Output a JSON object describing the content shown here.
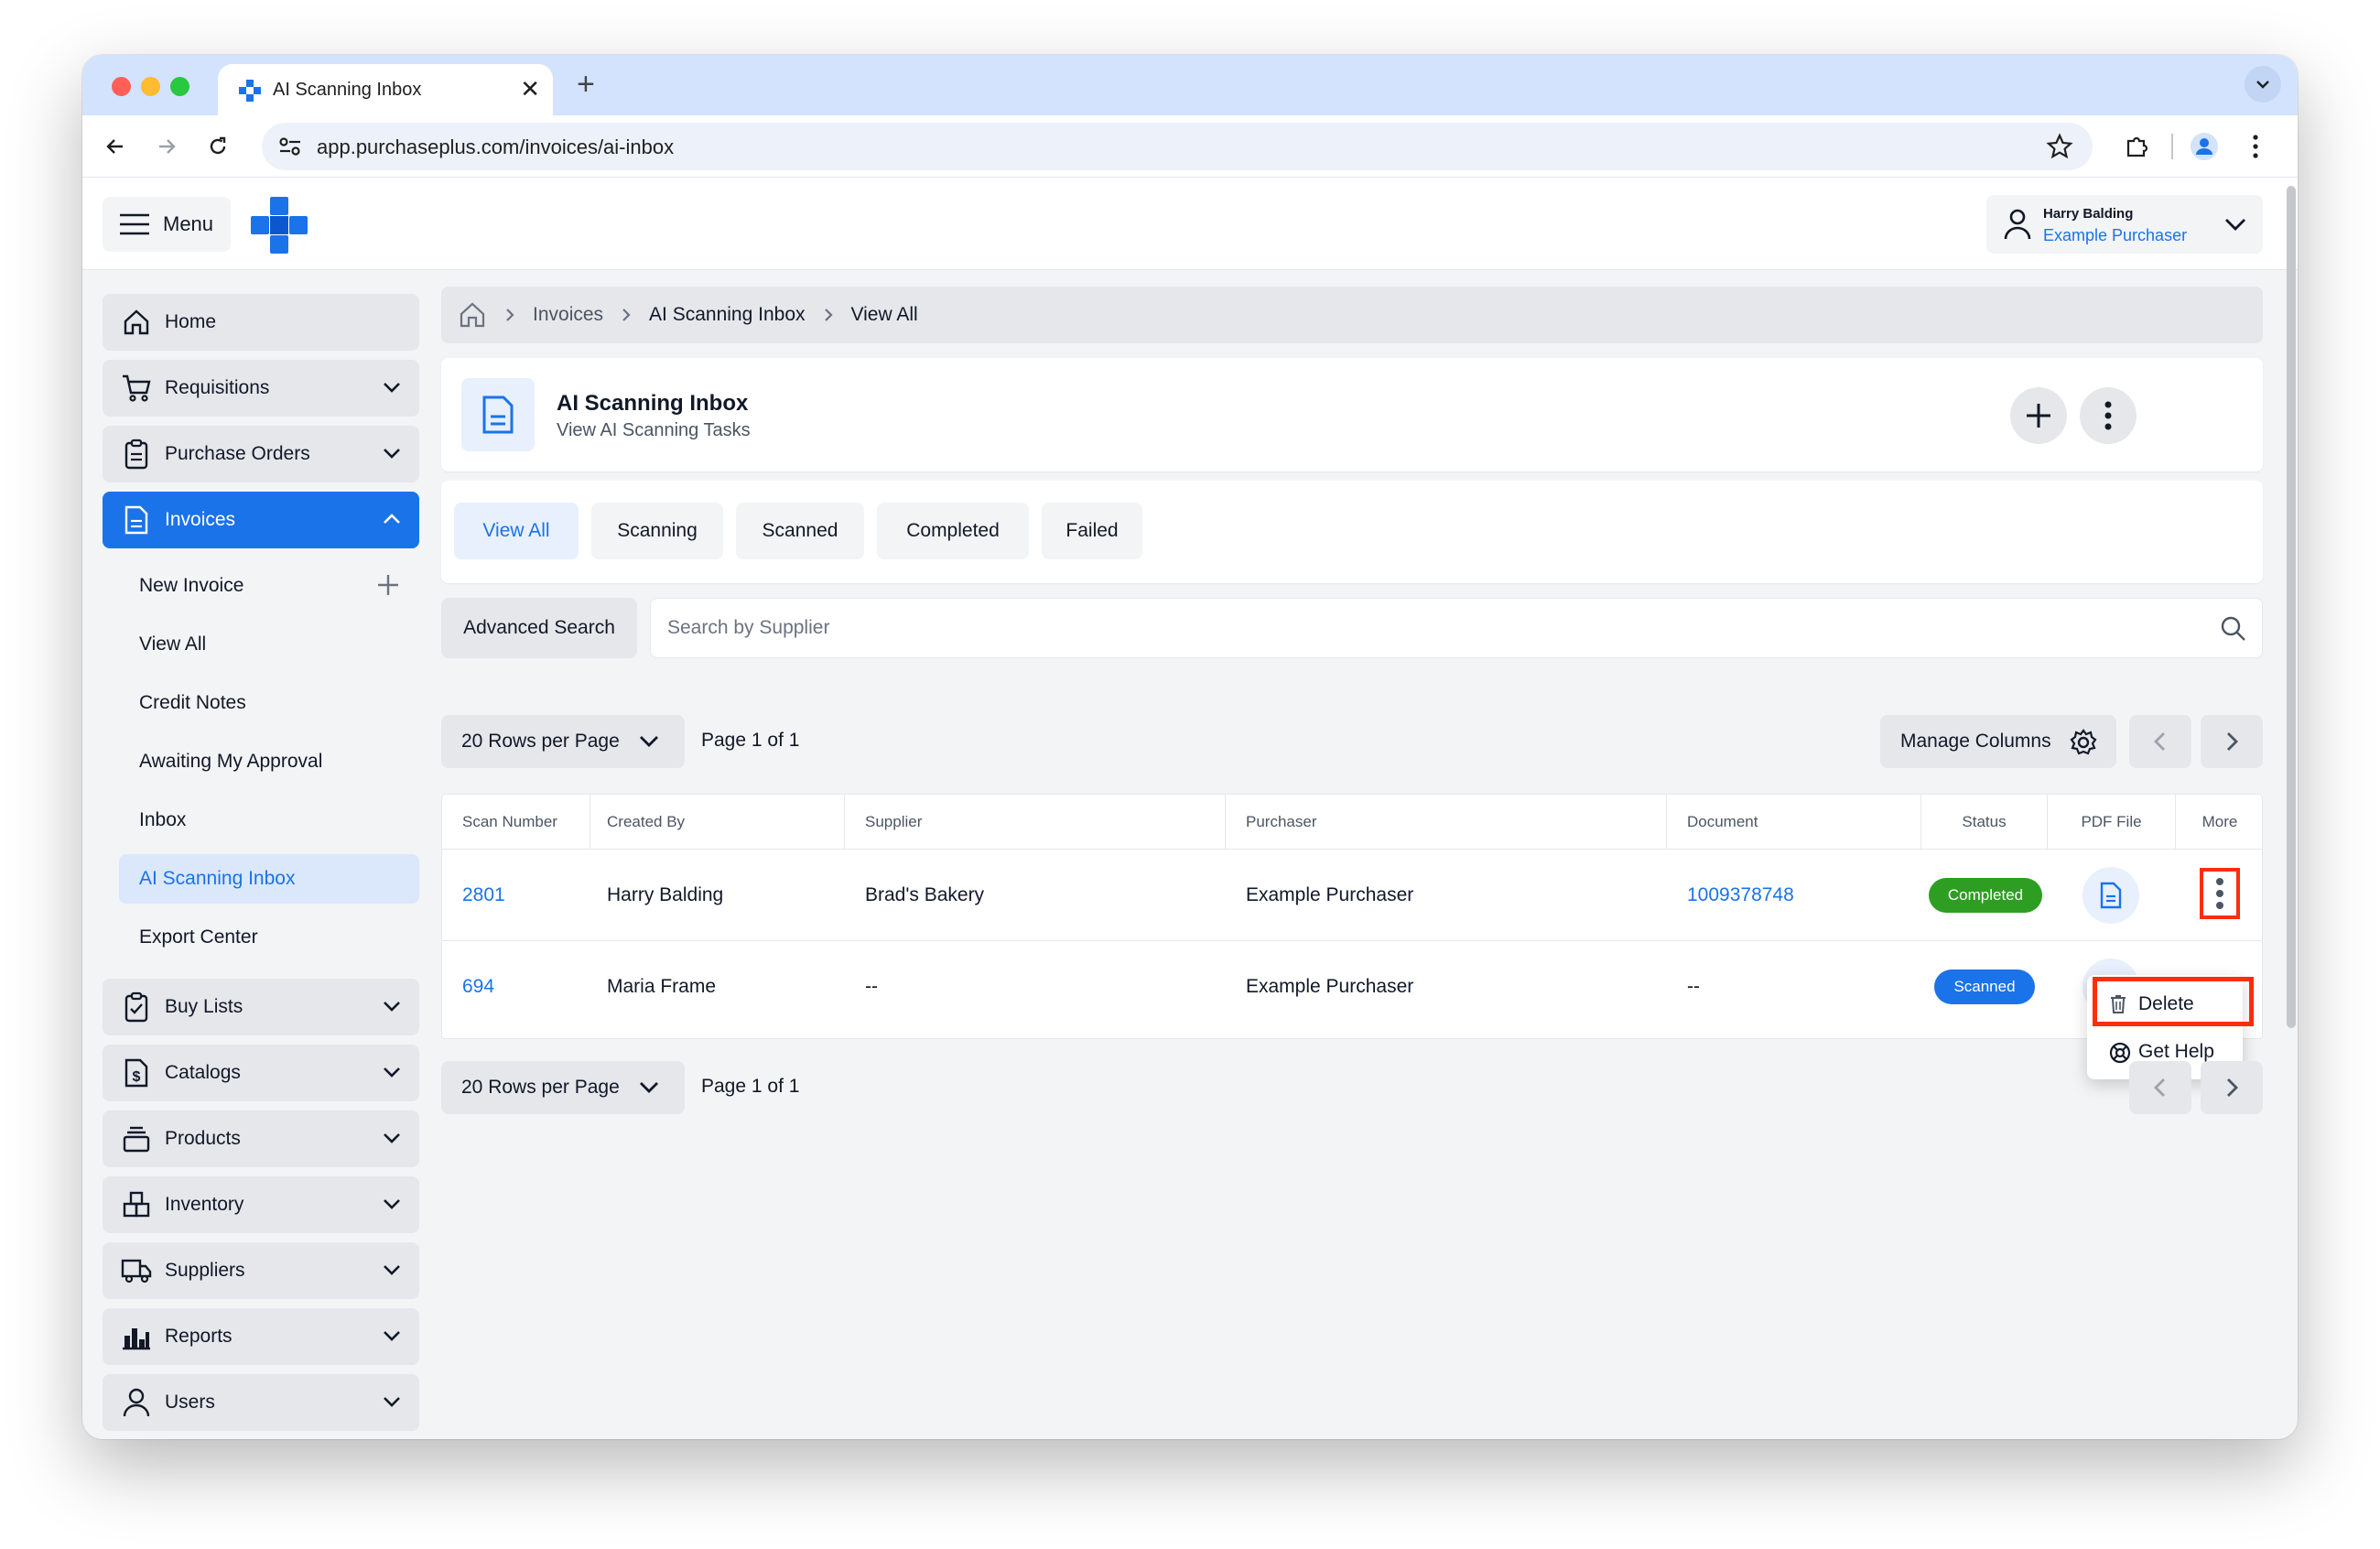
{
  "browser": {
    "tab_title": "AI Scanning Inbox",
    "tab_close": "✕",
    "new_tab": "+",
    "url": "app.purchaseplus.com/invoices/ai-inbox"
  },
  "appbar": {
    "menu_label": "Menu",
    "user_name": "Harry Balding",
    "user_role": "Example Purchaser"
  },
  "sidebar": {
    "items": [
      {
        "label": "Home",
        "icon": "home-icon"
      },
      {
        "label": "Requisitions",
        "icon": "cart-icon"
      },
      {
        "label": "Purchase Orders",
        "icon": "clipboard-icon"
      },
      {
        "label": "Invoices",
        "icon": "document-icon"
      },
      {
        "label": "Buy Lists",
        "icon": "checklist-icon"
      },
      {
        "label": "Catalogs",
        "icon": "dollar-doc-icon"
      },
      {
        "label": "Products",
        "icon": "products-icon"
      },
      {
        "label": "Inventory",
        "icon": "inventory-icon"
      },
      {
        "label": "Suppliers",
        "icon": "truck-icon"
      },
      {
        "label": "Reports",
        "icon": "bar-chart-icon"
      },
      {
        "label": "Users",
        "icon": "user-icon"
      }
    ],
    "invoice_subitems": [
      "New Invoice",
      "View All",
      "Credit Notes",
      "Awaiting My Approval",
      "Inbox",
      "AI Scanning Inbox",
      "Export Center"
    ]
  },
  "breadcrumb": [
    "Invoices",
    "AI Scanning Inbox",
    "View All"
  ],
  "header": {
    "title": "AI Scanning Inbox",
    "subtitle": "View AI Scanning Tasks"
  },
  "filter_tabs": [
    "View All",
    "Scanning",
    "Scanned",
    "Completed",
    "Failed"
  ],
  "search": {
    "advanced_label": "Advanced Search",
    "placeholder": "Search by Supplier"
  },
  "pagination": {
    "rows_per_page": "20 Rows per Page",
    "page_label": "Page 1 of 1",
    "manage_columns": "Manage Columns"
  },
  "table": {
    "columns": [
      "Scan Number",
      "Created By",
      "Supplier",
      "Purchaser",
      "Document",
      "Status",
      "PDF File",
      "More"
    ],
    "rows": [
      {
        "scan_number": "2801",
        "created_by": "Harry Balding",
        "supplier": "Brad's Bakery",
        "purchaser": "Example Purchaser",
        "document": "1009378748",
        "status": "Completed"
      },
      {
        "scan_number": "694",
        "created_by": "Maria Frame",
        "supplier": "--",
        "purchaser": "Example Purchaser",
        "document": "--",
        "status": "Scanned"
      }
    ]
  },
  "more_menu": {
    "delete": "Delete",
    "help": "Get Help"
  },
  "colors": {
    "accent": "#1a73e8",
    "completed": "#2e9e22",
    "scanned": "#1a73e8",
    "highlight": "#ff2d0a"
  }
}
